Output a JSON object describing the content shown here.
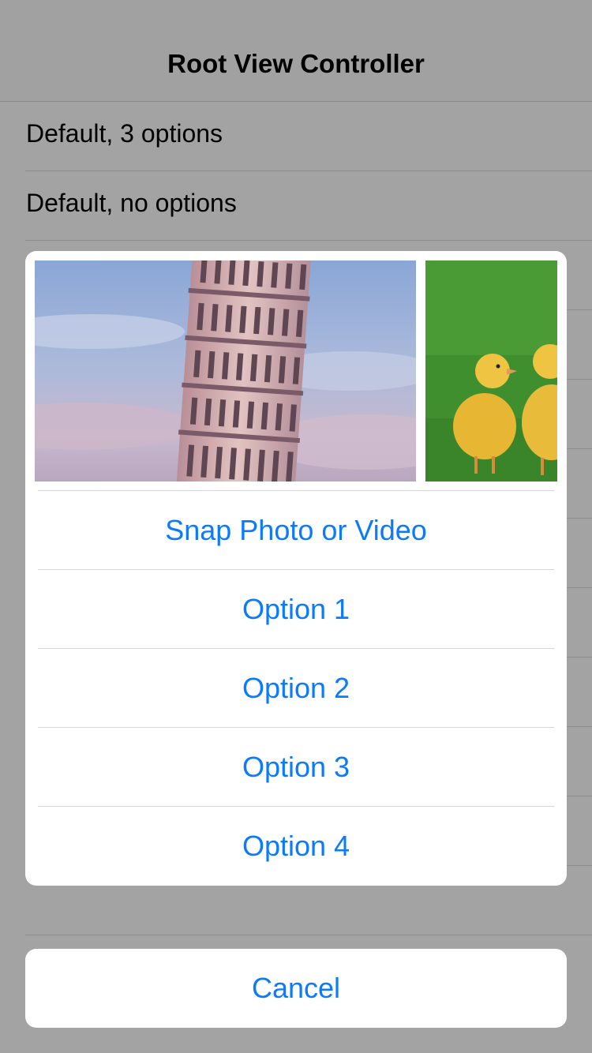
{
  "navbar": {
    "title": "Root View Controller"
  },
  "rows": [
    {
      "label": "Default, 3 options"
    },
    {
      "label": "Default, no options"
    },
    {
      "label": ""
    },
    {
      "label": ""
    },
    {
      "label": ""
    },
    {
      "label": ""
    },
    {
      "label": ""
    },
    {
      "label": ""
    },
    {
      "label": ""
    },
    {
      "label": ""
    },
    {
      "label": ""
    },
    {
      "label": ""
    }
  ],
  "sheet": {
    "photos": [
      {
        "subject": "leaning-tower"
      },
      {
        "subject": "ducklings"
      }
    ],
    "options": [
      {
        "label": "Snap Photo or Video"
      },
      {
        "label": "Option 1"
      },
      {
        "label": "Option 2"
      },
      {
        "label": "Option 3"
      },
      {
        "label": "Option 4"
      }
    ],
    "cancel_label": "Cancel"
  },
  "colors": {
    "accent": "#0a7aff",
    "dim_background": "#a3a3a3",
    "sheet_background": "#ffffff"
  }
}
